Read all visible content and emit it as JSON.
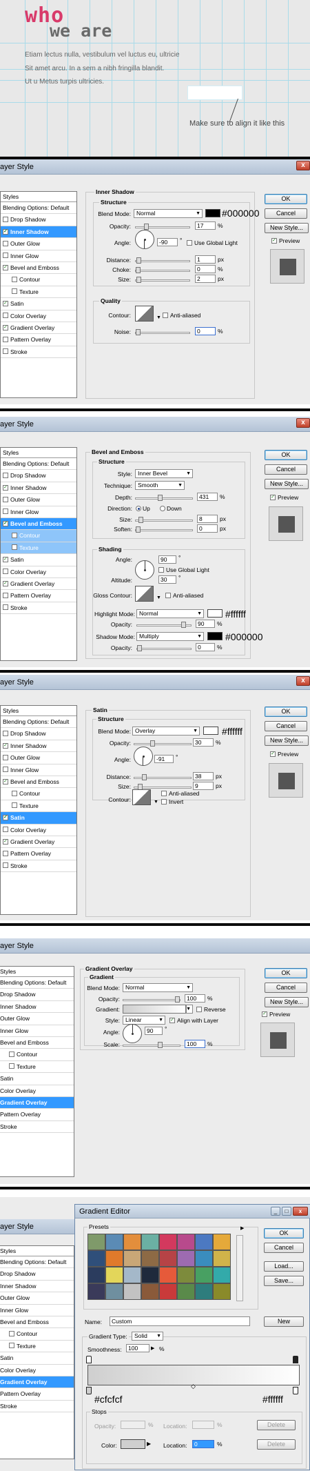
{
  "hero": {
    "title_who": "who",
    "title_weare": "we are",
    "lines": [
      "Etiam lectus nulla, vestibulum vel luctus eu, ultricie",
      "Sit amet arcu. In a sem a nibh fringilla blandit.",
      "Ut u Metus turpis ultricies."
    ],
    "note": "Make sure to align it like this",
    "colors": {
      "who": "#d83a6a",
      "weare": "#6a6a6a",
      "guides": "#a9dbe9"
    }
  },
  "common": {
    "window_title": "ayer Style",
    "styles_header": "Styles",
    "blending_options": "Blending Options: Default",
    "style_items": [
      "Drop Shadow",
      "Inner Shadow",
      "Outer Glow",
      "Inner Glow",
      "Bevel and Emboss",
      "Contour",
      "Texture",
      "Satin",
      "Color Overlay",
      "Gradient Overlay",
      "Pattern Overlay",
      "Stroke"
    ],
    "ok": "OK",
    "cancel": "Cancel",
    "new_style": "New Style...",
    "preview": "Preview",
    "check_mark": "✓",
    "close_x": "x",
    "dropdown_arrow": "▼"
  },
  "inner_shadow": {
    "section": "Inner Shadow",
    "structure": "Structure",
    "quality": "Quality",
    "blend_mode_label": "Blend Mode:",
    "blend_mode": "Normal",
    "color_hex": "#000000",
    "opacity_label": "Opacity:",
    "opacity": "17",
    "angle_label": "Angle:",
    "angle": "-90",
    "use_global_light": "Use Global Light",
    "distance_label": "Distance:",
    "distance": "1",
    "choke_label": "Choke:",
    "choke": "0",
    "size_label": "Size:",
    "size": "2",
    "contour_label": "Contour:",
    "anti_aliased": "Anti-aliased",
    "noise_label": "Noise:",
    "noise": "0",
    "pct": "%",
    "px": "px",
    "deg": "°",
    "levels": {
      "opacity": 0.17,
      "distance": 0.02,
      "choke": 0,
      "size": 0.02,
      "noise": 0
    }
  },
  "bevel": {
    "section": "Bevel and Emboss",
    "structure": "Structure",
    "shading": "Shading",
    "style_label": "Style:",
    "style": "Inner Bevel",
    "technique_label": "Technique:",
    "technique": "Smooth",
    "depth_label": "Depth:",
    "depth": "431",
    "direction_label": "Direction:",
    "up": "Up",
    "down": "Down",
    "size_label": "Size:",
    "size": "8",
    "soften_label": "Soften:",
    "soften": "0",
    "angle_label": "Angle:",
    "angle": "90",
    "use_global_light": "Use Global Light",
    "altitude_label": "Altitude:",
    "altitude": "30",
    "gloss_contour_label": "Gloss Contour:",
    "anti_aliased": "Anti-aliased",
    "highlight_label": "Highlight Mode:",
    "highlight_mode": "Normal",
    "highlight_hex": "#ffffff",
    "highlight_opacity_label": "Opacity:",
    "highlight_opacity": "90",
    "shadow_label": "Shadow Mode:",
    "shadow_mode": "Multiply",
    "shadow_hex": "#000000",
    "shadow_opacity_label": "Opacity:",
    "shadow_opacity": "0",
    "pct": "%",
    "px": "px",
    "deg": "°",
    "levels": {
      "depth": 0.43,
      "size": 0.05,
      "soften": 0,
      "highlight_opacity": 0.9,
      "shadow_opacity": 0
    }
  },
  "satin": {
    "section": "Satin",
    "structure": "Structure",
    "blend_mode_label": "Blend Mode:",
    "blend_mode": "Overlay",
    "color_hex": "#ffffff",
    "opacity_label": "Opacity:",
    "opacity": "30",
    "angle_label": "Angle:",
    "angle": "-91",
    "distance_label": "Distance:",
    "distance": "38",
    "size_label": "Size:",
    "size": "9",
    "contour_label": "Contour:",
    "anti_aliased": "Anti-aliased",
    "invert": "Invert",
    "pct": "%",
    "px": "px",
    "deg": "°",
    "levels": {
      "opacity": 0.3,
      "distance": 0.15,
      "size": 0.06
    }
  },
  "gradient_overlay": {
    "section": "Gradient Overlay",
    "gradient": "Gradient",
    "blend_mode_label": "Blend Mode:",
    "blend_mode": "Normal",
    "opacity_label": "Opacity:",
    "opacity": "100",
    "gradient_label": "Gradient:",
    "reverse": "Reverse",
    "style_label": "Style:",
    "style": "Linear",
    "align_with_layer": "Align with Layer",
    "angle_label": "Angle:",
    "angle": "90",
    "scale_label": "Scale:",
    "scale": "100",
    "pct": "%",
    "deg": "°",
    "levels": {
      "opacity": 1.0,
      "scale": 0.67
    }
  },
  "gradient_editor": {
    "title": "Gradient Editor",
    "presets": "Presets",
    "ok": "OK",
    "cancel": "Cancel",
    "load": "Load...",
    "save": "Save...",
    "new": "New",
    "name_label": "Name:",
    "name": "Custom",
    "gradient_type_label": "Gradient Type:",
    "gradient_type": "Solid",
    "smoothness_label": "Smoothness:",
    "smoothness": "100",
    "left_hex": "#cfcfcf",
    "right_hex": "#ffffff",
    "stops": "Stops",
    "opacity_label": "Opacity:",
    "location_label": "Location:",
    "delete": "Delete",
    "color_label": "Color:",
    "location": "0",
    "pct": "%",
    "arrow_right": "▶",
    "play_icon": "▶",
    "minimize": "_",
    "maximize": "□",
    "close": "x",
    "preset_colors": [
      "#7f9a6a",
      "#5b8bb5",
      "#e38e3c",
      "#6bb0a3",
      "#d3395e",
      "#b84a8c",
      "#4c79c2",
      "#e5a93a",
      "#2f4f7a",
      "#e07a2b",
      "#c9a777",
      "#8d6a45",
      "#b64346",
      "#9d6bb1",
      "#3a8dbe",
      "#d0b34a",
      "#2b3c5e",
      "#e3d65a",
      "#a4b8c9",
      "#1f2a3c",
      "#e65a3a",
      "#7d8b3c",
      "#48a062",
      "#33aaaa",
      "#3a3a5a",
      "#6f8f9f",
      "#c2c2c2",
      "#8a5a3a",
      "#c93a3a",
      "#5a8a4a",
      "#2e7d7d",
      "#8a8a2a"
    ]
  }
}
